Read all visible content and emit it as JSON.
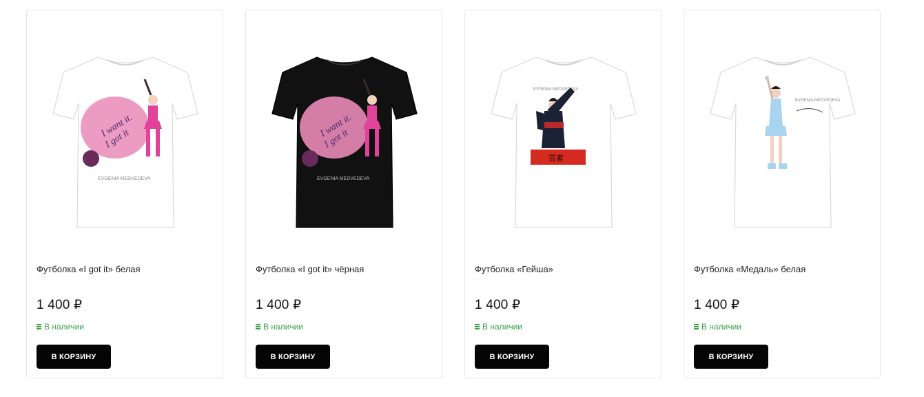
{
  "products": [
    {
      "title": "Футболка «I got it» белая",
      "price": "1 400 ₽",
      "stock": "В наличии",
      "button": "В КОРЗИНУ",
      "shirt_color": "#ffffff",
      "art": "pink-splash",
      "print_text_1": "I want it.",
      "print_text_2": "I got it",
      "print_caption": "EVGENIA MEDVEDEVA"
    },
    {
      "title": "Футболка «I got it» чёрная",
      "price": "1 400 ₽",
      "stock": "В наличии",
      "button": "В КОРЗИНУ",
      "shirt_color": "#111111",
      "art": "pink-splash",
      "print_text_1": "I want it.",
      "print_text_2": "I got it",
      "print_caption": "EVGENIA MEDVEDEVA"
    },
    {
      "title": "Футболка «Гейша»",
      "price": "1 400 ₽",
      "stock": "В наличии",
      "button": "В КОРЗИНУ",
      "shirt_color": "#ffffff",
      "art": "geisha",
      "print_caption": "EVGENIA MEDVEDEVA",
      "print_text_1": "芸者"
    },
    {
      "title": "Футболка «Медаль» белая",
      "price": "1 400 ₽",
      "stock": "В наличии",
      "button": "В КОРЗИНУ",
      "shirt_color": "#ffffff",
      "art": "medal",
      "print_caption": "EVGENIA MEDVEDEVA"
    }
  ],
  "colors": {
    "accent_button": "#050505",
    "in_stock": "#3aa14a",
    "card_border": "#e6e6e6",
    "print_pink": "#e98ab8",
    "geisha_red": "#d42a1f",
    "medal_blue": "#a8d4f0"
  }
}
